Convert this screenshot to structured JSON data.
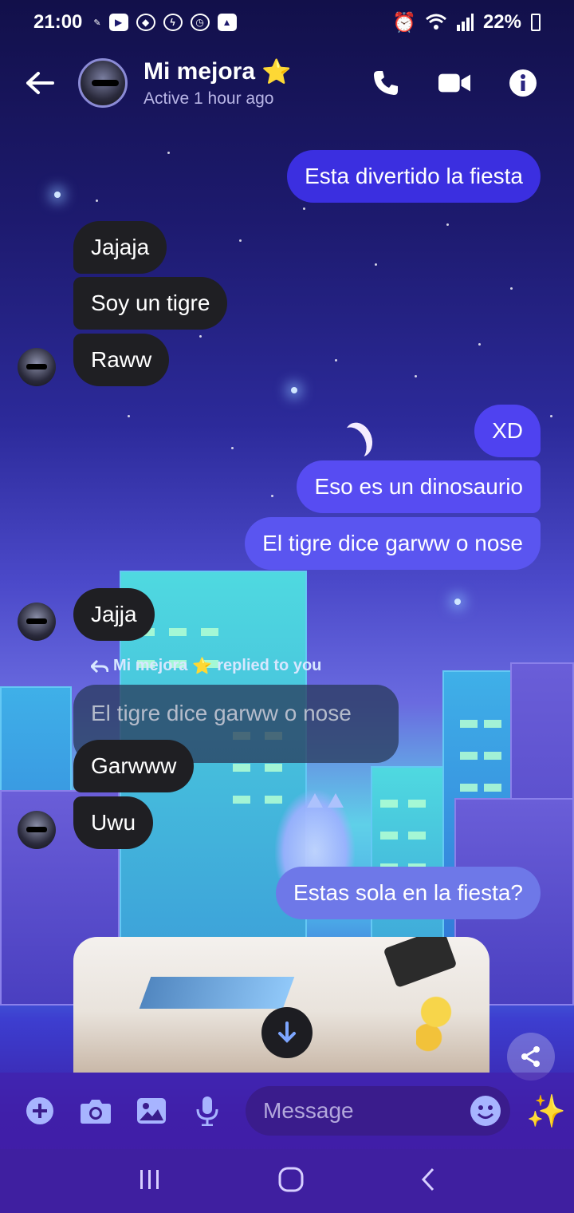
{
  "status_bar": {
    "time": "21:00",
    "battery": "22%"
  },
  "header": {
    "contact_name": "Mi mejora",
    "name_emoji": "⭐",
    "active_status": "Active 1 hour ago"
  },
  "messages": [
    {
      "direction": "out",
      "text": "Esta divertido la fiesta"
    },
    {
      "direction": "in",
      "text": "Jajaja"
    },
    {
      "direction": "in",
      "text": "Soy un tigre"
    },
    {
      "direction": "in",
      "text": "Raww"
    },
    {
      "direction": "out",
      "text": "XD"
    },
    {
      "direction": "out",
      "text": "Eso es un dinosaurio"
    },
    {
      "direction": "out",
      "text": "El tigre dice garww o nose"
    },
    {
      "direction": "in",
      "text": "Jajja"
    },
    {
      "direction": "in",
      "text": "Garwww"
    },
    {
      "direction": "in",
      "text": "Uwu"
    },
    {
      "direction": "out",
      "text": "Estas sola en la fiesta?"
    }
  ],
  "reply": {
    "label_name": "Mi mejora",
    "label_suffix": "replied to you",
    "quoted_text": "El tigre dice garww o nose"
  },
  "composer": {
    "placeholder": "Message"
  },
  "colors": {
    "outgoing_bubble": "#4f42f0",
    "incoming_bubble": "#1f1f23",
    "accent_icon": "#a7b4ff"
  },
  "icons": {
    "back": "arrow-left-icon",
    "call": "phone-icon",
    "video": "video-camera-icon",
    "info": "info-icon",
    "add": "plus-circle-icon",
    "camera": "camera-icon",
    "gallery": "image-icon",
    "mic": "microphone-icon",
    "emoji": "smiley-icon",
    "sparkle": "sparkle-icon",
    "share": "share-icon",
    "scroll": "arrow-down-icon"
  }
}
